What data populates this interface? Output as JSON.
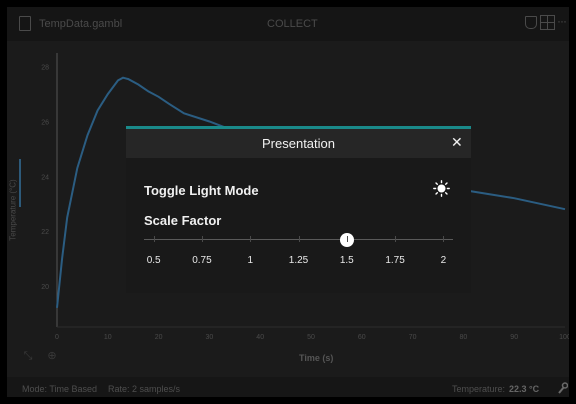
{
  "app": {
    "file_name": "TempData.gambl",
    "mode_title": "COLLECT"
  },
  "graph": {
    "y_axis_label": "Temperature (°C)",
    "x_axis_label": "Time (s)",
    "line_color": "#2b5d82"
  },
  "chart_data": {
    "type": "line",
    "xlabel": "Time (s)",
    "ylabel": "Temperature (°C)",
    "xlim": [
      0,
      100
    ],
    "ylim": [
      18.5,
      28.5
    ],
    "x_ticks": [
      "0",
      "10",
      "20",
      "30",
      "40",
      "50",
      "60",
      "70",
      "80",
      "90",
      "100"
    ],
    "y_ticks": [
      "20",
      "22",
      "24",
      "26",
      "28"
    ],
    "series": [
      {
        "x": [
          0,
          1,
          2,
          4,
          6,
          8,
          10,
          12,
          13,
          14,
          16,
          18,
          20,
          22,
          25,
          30,
          40,
          50,
          60,
          70,
          80,
          85,
          90,
          95,
          100
        ],
        "y": [
          19.2,
          21.0,
          22.5,
          24.3,
          25.5,
          26.4,
          27.0,
          27.5,
          27.6,
          27.55,
          27.35,
          27.1,
          26.9,
          26.65,
          26.3,
          26.0,
          25.3,
          24.8,
          24.3,
          23.9,
          23.5,
          23.35,
          23.2,
          23.0,
          22.8
        ]
      }
    ]
  },
  "footer": {
    "mode": "Mode: Time Based",
    "rate": "Rate: 2 samples/s",
    "temp_label": "Temperature:",
    "temp_value": "22.3 °C"
  },
  "modal": {
    "title": "Presentation",
    "close_label": "✕",
    "toggle_light_mode_label": "Toggle Light Mode",
    "scale_factor_label": "Scale Factor",
    "scale_options": [
      "0.5",
      "0.75",
      "1",
      "1.25",
      "1.5",
      "1.75",
      "2"
    ],
    "scale_selected": "1.5",
    "accent_color": "#1a8a8a"
  }
}
